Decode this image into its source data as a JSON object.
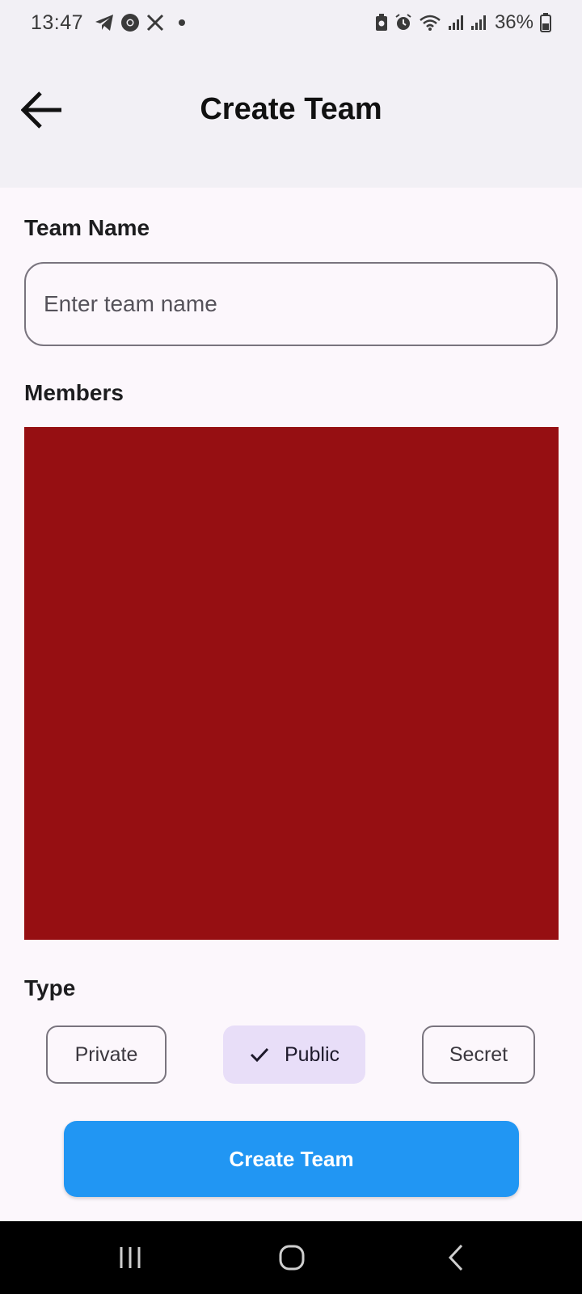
{
  "status_bar": {
    "time": "13:47",
    "battery_percent": "36%",
    "left_icons": [
      "telegram-icon",
      "chrome-icon",
      "x-icon",
      "notification-dot"
    ],
    "right_icons": [
      "battery-saver-icon",
      "alarm-icon",
      "wifi-icon",
      "signal-icon",
      "signal-icon-2",
      "battery-icon"
    ]
  },
  "app_bar": {
    "back_icon": "arrow-left-icon",
    "title": "Create Team"
  },
  "form": {
    "team_name_label": "Team Name",
    "team_name_value": "",
    "team_name_placeholder": "Enter team name",
    "members_label": "Members",
    "type_label": "Type",
    "types": [
      {
        "label": "Private",
        "selected": false
      },
      {
        "label": "Public",
        "selected": true,
        "icon": "check-icon"
      },
      {
        "label": "Secret",
        "selected": false
      }
    ],
    "submit_label": "Create Team"
  },
  "colors": {
    "members_panel": "#960f12",
    "primary_button": "#2196f3",
    "selected_chip": "#e8def8"
  },
  "nav_bar": {
    "icons": [
      "recents-icon",
      "home-icon",
      "back-icon"
    ]
  }
}
